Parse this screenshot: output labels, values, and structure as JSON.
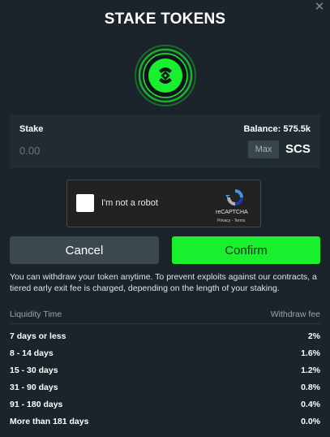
{
  "dialog": {
    "title": "STAKE TOKENS",
    "close_glyph": "✕"
  },
  "stake": {
    "label": "Stake",
    "balance_label": "Balance: 575.5k",
    "placeholder": "0.00",
    "max_label": "Max",
    "token": "SCS"
  },
  "captcha": {
    "text": "I'm not a robot",
    "brand": "reCAPTCHA",
    "links": "Privacy - Terms"
  },
  "buttons": {
    "cancel": "Cancel",
    "confirm": "Confirm"
  },
  "info": "You can withdraw your token anytime. To prevent exploits against our contracts, a tiered early exit fee is charged, depending on the length of your staking.",
  "fees": {
    "header_time": "Liquidity Time",
    "header_fee": "Withdraw fee",
    "rows": [
      {
        "time": "7 days or less",
        "fee": "2%"
      },
      {
        "time": "8 - 14 days",
        "fee": "1.6%"
      },
      {
        "time": "15 - 30 days",
        "fee": "1.2%"
      },
      {
        "time": "31 - 90 days",
        "fee": "0.8%"
      },
      {
        "time": "91 - 180 days",
        "fee": "0.4%"
      },
      {
        "time": "More than 181 days",
        "fee": "0.0%"
      }
    ]
  },
  "colors": {
    "background": "#1b242a",
    "accent_green": "#19f02d",
    "panel": "#212b32"
  }
}
